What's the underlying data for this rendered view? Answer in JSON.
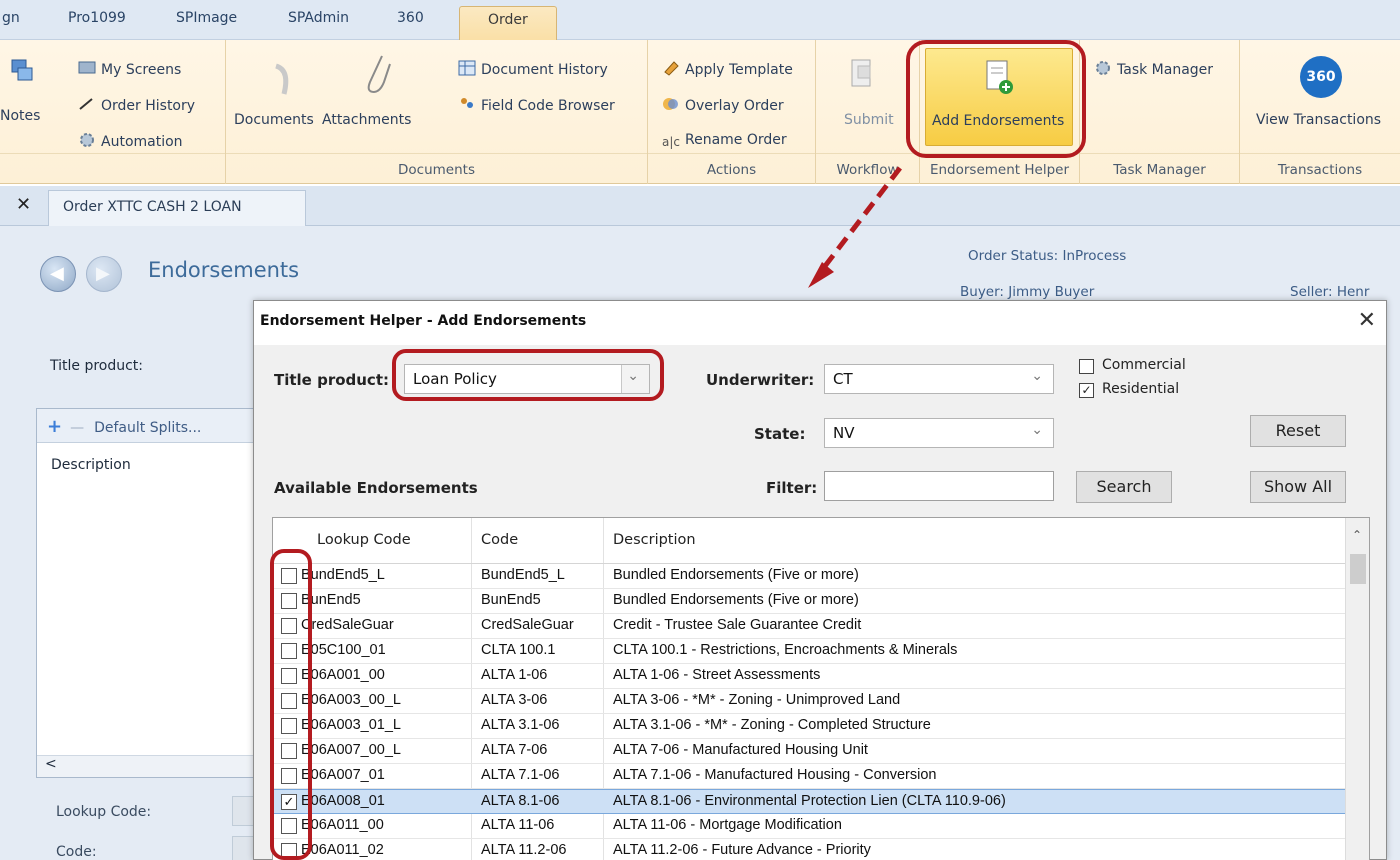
{
  "ribbon": {
    "tabs": [
      {
        "label": "gn"
      },
      {
        "label": "Pro1099"
      },
      {
        "label": "SPImage"
      },
      {
        "label": "SPAdmin"
      },
      {
        "label": "360"
      },
      {
        "label": "Order",
        "active": true
      }
    ],
    "items": {
      "notes": "Notes",
      "my_screens": "My Screens",
      "order_history": "Order History",
      "automation": "Automation",
      "documents": "Documents",
      "attachments": "Attachments",
      "document_history": "Document History",
      "field_code_browser": "Field Code Browser",
      "apply_template": "Apply Template",
      "overlay_order": "Overlay Order",
      "rename_order": "Rename Order",
      "submit": "Submit",
      "add_endorsements": "Add Endorsements",
      "task_manager": "Task Manager",
      "view_transactions": "View Transactions",
      "badge_360": "360"
    },
    "groups": {
      "documents": "Documents",
      "actions": "Actions",
      "workflow": "Workflow",
      "endorsement_helper": "Endorsement Helper",
      "task_manager": "Task Manager",
      "transactions": "Transactions"
    }
  },
  "doc_tab": {
    "close": "✕",
    "label": "Order XTTC CASH 2 LOAN"
  },
  "page": {
    "title": "Endorsements",
    "order_status": "Order Status: InProcess",
    "buyer": "Buyer: Jimmy Buyer",
    "seller": "Seller: Henr",
    "title_product_label": "Title product:",
    "default_splits": "Default Splits...",
    "description_label": "Description",
    "scroll_left": "<",
    "lookup_code_label": "Lookup Code:",
    "code_label": "Code:"
  },
  "dialog": {
    "title": "Endorsement Helper - Add Endorsements",
    "close": "✕",
    "title_product_label": "Title product:",
    "title_product_value": "Loan Policy",
    "underwriter_label": "Underwriter:",
    "underwriter_value": "CT",
    "state_label": "State:",
    "state_value": "NV",
    "commercial_label": "Commercial",
    "commercial_checked": false,
    "residential_label": "Residential",
    "residential_checked": true,
    "reset_button": "Reset",
    "available_label": "Available Endorsements",
    "filter_label": "Filter:",
    "filter_value": "",
    "search_button": "Search",
    "show_all_button": "Show All",
    "columns": [
      "Lookup Code",
      "Code",
      "Description"
    ],
    "rows": [
      {
        "lookup": "BundEnd5_L",
        "code": "BundEnd5_L",
        "desc": "Bundled Endorsements (Five or more)",
        "checked": false
      },
      {
        "lookup": "BunEnd5",
        "code": "BunEnd5",
        "desc": "Bundled Endorsements (Five or more)",
        "checked": false
      },
      {
        "lookup": "CredSaleGuar",
        "code": "CredSaleGuar",
        "desc": "Credit - Trustee Sale Guarantee Credit",
        "checked": false
      },
      {
        "lookup": "E05C100_01",
        "code": "CLTA 100.1",
        "desc": "CLTA 100.1 - Restrictions, Encroachments & Minerals",
        "checked": false
      },
      {
        "lookup": "E06A001_00",
        "code": "ALTA 1-06",
        "desc": "ALTA 1-06 - Street Assessments",
        "checked": false
      },
      {
        "lookup": "E06A003_00_L",
        "code": "ALTA 3-06",
        "desc": "ALTA 3-06 - *M* - Zoning - Unimproved Land",
        "checked": false
      },
      {
        "lookup": "E06A003_01_L",
        "code": "ALTA 3.1-06",
        "desc": "ALTA 3.1-06 - *M* - Zoning - Completed Structure",
        "checked": false
      },
      {
        "lookup": "E06A007_00_L",
        "code": "ALTA 7-06",
        "desc": "ALTA 7-06 - Manufactured Housing Unit",
        "checked": false
      },
      {
        "lookup": "E06A007_01",
        "code": "ALTA 7.1-06",
        "desc": "ALTA 7.1-06 - Manufactured Housing - Conversion",
        "checked": false
      },
      {
        "lookup": "E06A008_01",
        "code": "ALTA 8.1-06",
        "desc": "ALTA 8.1-06 - Environmental Protection Lien (CLTA 110.9-06)",
        "checked": true,
        "selected": true
      },
      {
        "lookup": "E06A011_00",
        "code": "ALTA 11-06",
        "desc": "ALTA 11-06 - Mortgage Modification",
        "checked": false
      },
      {
        "lookup": "E06A011_02",
        "code": "ALTA 11.2-06",
        "desc": "ALTA 11.2-06 - Future Advance - Priority",
        "checked": false
      }
    ]
  },
  "colors": {
    "annotation_red": "#b31b20",
    "active_tab": "#fadfa5",
    "highlight_button": "#f7cc43",
    "selected_row": "#cde0f5"
  }
}
